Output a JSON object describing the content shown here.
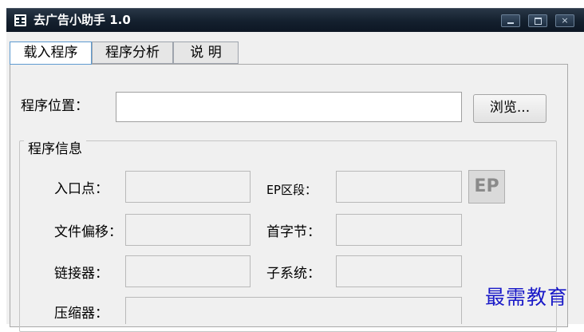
{
  "window": {
    "title": "去广告小助手 1.0",
    "close_glyph": "×"
  },
  "tabs": [
    {
      "label": "载入程序",
      "active": true
    },
    {
      "label": "程序分析",
      "active": false
    },
    {
      "label": "说 明",
      "active": false
    }
  ],
  "load_tab": {
    "path_label": "程序位置：",
    "path_value": "",
    "browse_label": "浏览...",
    "group_title": "程序信息",
    "fields": {
      "entry_point": {
        "label": "入口点：",
        "value": ""
      },
      "file_offset": {
        "label": "文件偏移：",
        "value": ""
      },
      "linker": {
        "label": "链接器：",
        "value": ""
      },
      "packer": {
        "label": "压缩器：",
        "value": ""
      },
      "ep_section": {
        "label": "EP区段：",
        "value": ""
      },
      "first_bytes": {
        "label": "首字节：",
        "value": ""
      },
      "subsystem": {
        "label": "子系统：",
        "value": ""
      }
    },
    "ep_button_label": "EP"
  },
  "watermark": "最需教育"
}
